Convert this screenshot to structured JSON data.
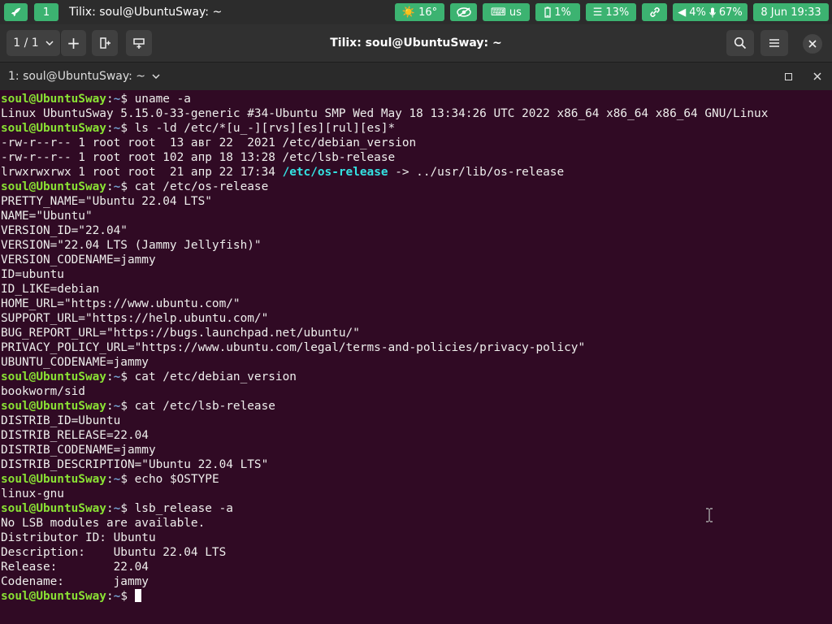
{
  "topbar": {
    "workspace": "1",
    "window_title": "Tilix: soul@UbuntuSway: ~",
    "modules": {
      "weather": "☀️ 16°",
      "keyboard": "⌨ us",
      "battery": "1%",
      "memory": "13%",
      "volume": "4%",
      "mic": "67%",
      "datetime": "8 Jun 19:33"
    }
  },
  "header": {
    "session_counter": "1 / 1",
    "title": "Tilix: soul@UbuntuSway: ~"
  },
  "session": {
    "label": "1: soul@UbuntuSway: ~"
  },
  "terminal": {
    "prompt_user": "soul@UbuntuSway",
    "prompt_sep": ":",
    "prompt_path": "~",
    "prompt_end": "$ ",
    "cmd1": "uname -a",
    "out1": "Linux UbuntuSway 5.15.0-33-generic #34-Ubuntu SMP Wed May 18 13:34:26 UTC 2022 x86_64 x86_64 x86_64 GNU/Linux",
    "cmd2": "ls -ld /etc/*[u_-][rvs][es][rul][es]*",
    "out2a": "-rw-r--r-- 1 root root  13 авг 22  2021 /etc/debian_version",
    "out2b": "-rw-r--r-- 1 root root 102 апр 18 13:28 /etc/lsb-release",
    "out2c_pre": "lrwxrwxrwx 1 root root  21 апр 22 17:34 ",
    "out2c_link": "/etc/os-release",
    "out2c_post": " -> ../usr/lib/os-release",
    "cmd3": "cat /etc/os-release",
    "os_release": [
      "PRETTY_NAME=\"Ubuntu 22.04 LTS\"",
      "NAME=\"Ubuntu\"",
      "VERSION_ID=\"22.04\"",
      "VERSION=\"22.04 LTS (Jammy Jellyfish)\"",
      "VERSION_CODENAME=jammy",
      "ID=ubuntu",
      "ID_LIKE=debian",
      "HOME_URL=\"https://www.ubuntu.com/\"",
      "SUPPORT_URL=\"https://help.ubuntu.com/\"",
      "BUG_REPORT_URL=\"https://bugs.launchpad.net/ubuntu/\"",
      "PRIVACY_POLICY_URL=\"https://www.ubuntu.com/legal/terms-and-policies/privacy-policy\"",
      "UBUNTU_CODENAME=jammy"
    ],
    "cmd4": "cat /etc/debian_version",
    "out4": "bookworm/sid",
    "cmd5": "cat /etc/lsb-release",
    "lsb_release_file": [
      "DISTRIB_ID=Ubuntu",
      "DISTRIB_RELEASE=22.04",
      "DISTRIB_CODENAME=jammy",
      "DISTRIB_DESCRIPTION=\"Ubuntu 22.04 LTS\""
    ],
    "cmd6": "echo $OSTYPE",
    "out6": "linux-gnu",
    "cmd7": "lsb_release -a",
    "lsb_output": [
      "No LSB modules are available.",
      "Distributor ID: Ubuntu",
      "Description:    Ubuntu 22.04 LTS",
      "Release:        22.04",
      "Codename:       jammy"
    ]
  }
}
